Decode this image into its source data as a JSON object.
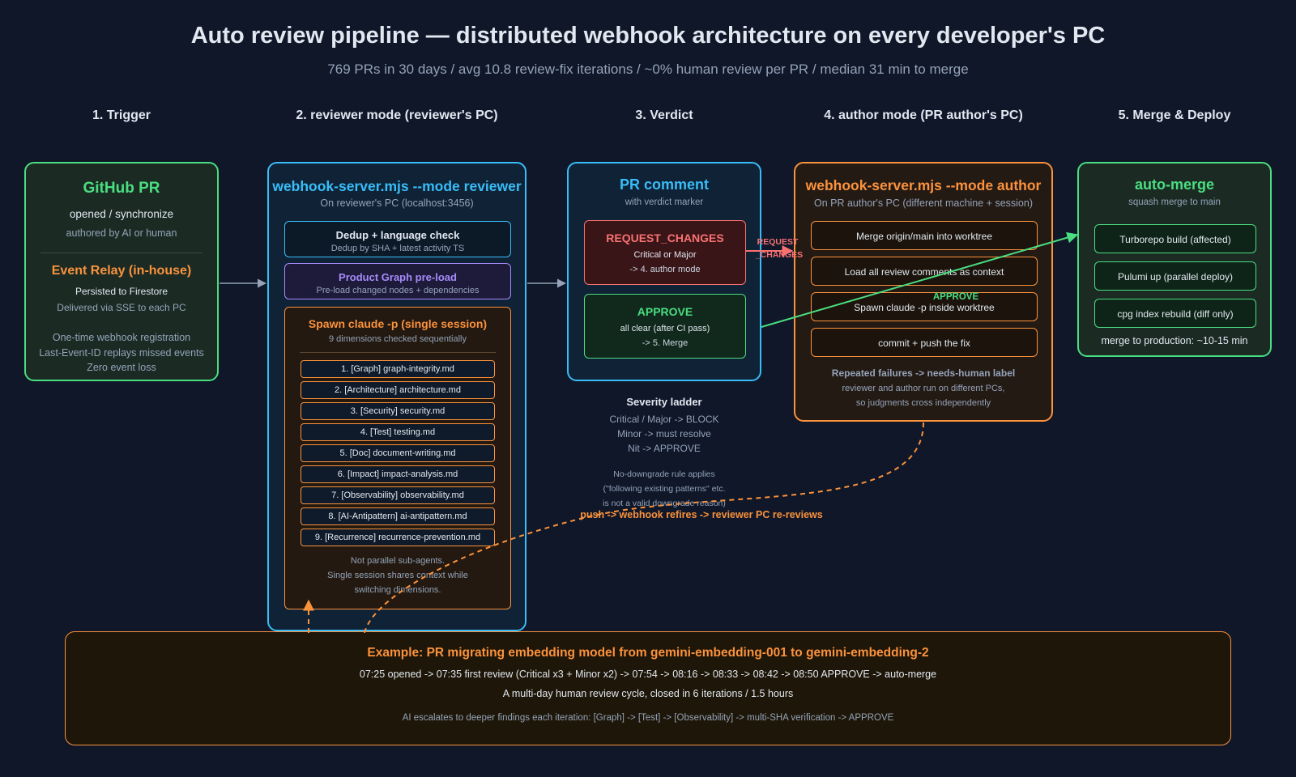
{
  "title": "Auto review pipeline — distributed webhook architecture on every developer's PC",
  "subtitle": "769 PRs in 30 days / avg 10.8 review-fix iterations / ~0% human review per PR / median 31 min to merge",
  "columns": [
    "1. Trigger",
    "2. reviewer mode (reviewer's PC)",
    "3. Verdict",
    "4. author mode (PR author's PC)",
    "5. Merge & Deploy"
  ],
  "trigger": {
    "title": "GitHub PR",
    "line1": "opened / synchronize",
    "line2": "authored by AI or human",
    "relay_title": "Event Relay (in-house)",
    "relay_line1": "Persisted to Firestore",
    "relay_line2": "Delivered via SSE to each PC",
    "notes": [
      "One-time webhook registration",
      "Last-Event-ID replays missed events",
      "Zero event loss"
    ]
  },
  "reviewer": {
    "title": "webhook-server.mjs --mode reviewer",
    "subtitle": "On reviewer's PC (localhost:3456)",
    "dedup_title": "Dedup + language check",
    "dedup_sub": "Dedup by SHA + latest activity TS",
    "graph_title": "Product Graph pre-load",
    "graph_sub": "Pre-load changed nodes + dependencies",
    "spawn_title": "Spawn claude -p (single session)",
    "spawn_sub": "9 dimensions checked sequentially",
    "dimensions": [
      "1. [Graph] graph-integrity.md",
      "2. [Architecture] architecture.md",
      "3. [Security] security.md",
      "4. [Test] testing.md",
      "5. [Doc] document-writing.md",
      "6. [Impact] impact-analysis.md",
      "7. [Observability] observability.md",
      "8. [AI-Antipattern] ai-antipattern.md",
      "9. [Recurrence] recurrence-prevention.md"
    ],
    "footer": [
      "Not parallel sub-agents.",
      "Single session shares context while",
      "switching dimensions."
    ]
  },
  "verdict": {
    "title": "PR comment",
    "subtitle": "with verdict marker",
    "rc_title": "REQUEST_CHANGES",
    "rc_line1": "Critical or Major",
    "rc_line2": "-> 4. author mode",
    "ap_title": "APPROVE",
    "ap_line1": "all clear (after CI pass)",
    "ap_line2": "-> 5. Merge",
    "ladder_title": "Severity ladder",
    "ladder": [
      "Critical / Major -> BLOCK",
      "Minor -> must resolve",
      "Nit -> APPROVE"
    ],
    "rule": [
      "No-downgrade rule applies",
      "(\"following existing patterns\" etc.",
      "is not a valid downgrade reason)"
    ]
  },
  "author": {
    "title": "webhook-server.mjs --mode author",
    "subtitle": "On PR author's PC (different machine + session)",
    "steps": [
      "Merge origin/main into worktree",
      "Load all review comments as context",
      "Spawn claude -p inside worktree",
      "commit + push the fix"
    ],
    "fail_title": "Repeated failures -> needs-human label",
    "fail_lines": [
      "reviewer and author run on different PCs,",
      "so judgments cross independently"
    ]
  },
  "merge": {
    "title": "auto-merge",
    "subtitle": "squash merge to main",
    "steps": [
      "Turborepo build (affected)",
      "Pulumi up (parallel deploy)",
      "cpg index rebuild (diff only)"
    ],
    "footer": "merge to production: ~10-15 min"
  },
  "edge_labels": {
    "request_changes": [
      "REQUEST",
      "_CHANGES"
    ],
    "approve": "APPROVE",
    "refire": "push -> webhook refires -> reviewer PC re-reviews"
  },
  "example": {
    "title": "Example: PR migrating embedding model from gemini-embedding-001 to gemini-embedding-2",
    "line1": "07:25 opened -> 07:35 first review (Critical x3 + Minor x2) -> 07:54 -> 08:16 -> 08:33 -> 08:42 -> 08:50 APPROVE -> auto-merge",
    "line2": "A multi-day human review cycle, closed in 6 iterations / 1.5 hours",
    "line3": "AI escalates to deeper findings each iteration: [Graph] -> [Test] -> [Observability] -> multi-SHA verification -> APPROVE"
  },
  "colors": {
    "background": "#0f1729",
    "green": "#4ade80",
    "blue": "#38bdf8",
    "orange": "#fb923c",
    "purple": "#a78bfa",
    "red": "#f87171"
  }
}
